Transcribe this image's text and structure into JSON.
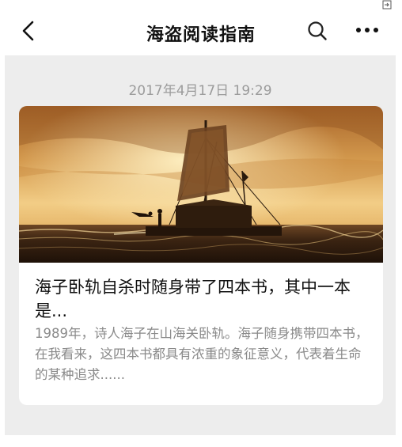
{
  "header": {
    "title": "海盗阅读指南"
  },
  "article": {
    "timestamp": "2017年4月17日 19:29",
    "title": "海子卧轨自杀时随身带了四本书，其中一本是...",
    "summary": "1989年，诗人海子在山海关卧轨。海子随身携带四本书，在我看来，这四本书都具有浓重的象征意义，代表着生命的某种追求......"
  },
  "icons": {
    "back": "back-arrow-icon",
    "search": "search-icon",
    "more": "more-dots-icon",
    "corner": "exit-icon"
  },
  "colors": {
    "background": "#ededed",
    "card": "#ffffff",
    "timestamp": "#9b9b9b",
    "title": "#111111",
    "summary": "#8a8a8a"
  }
}
